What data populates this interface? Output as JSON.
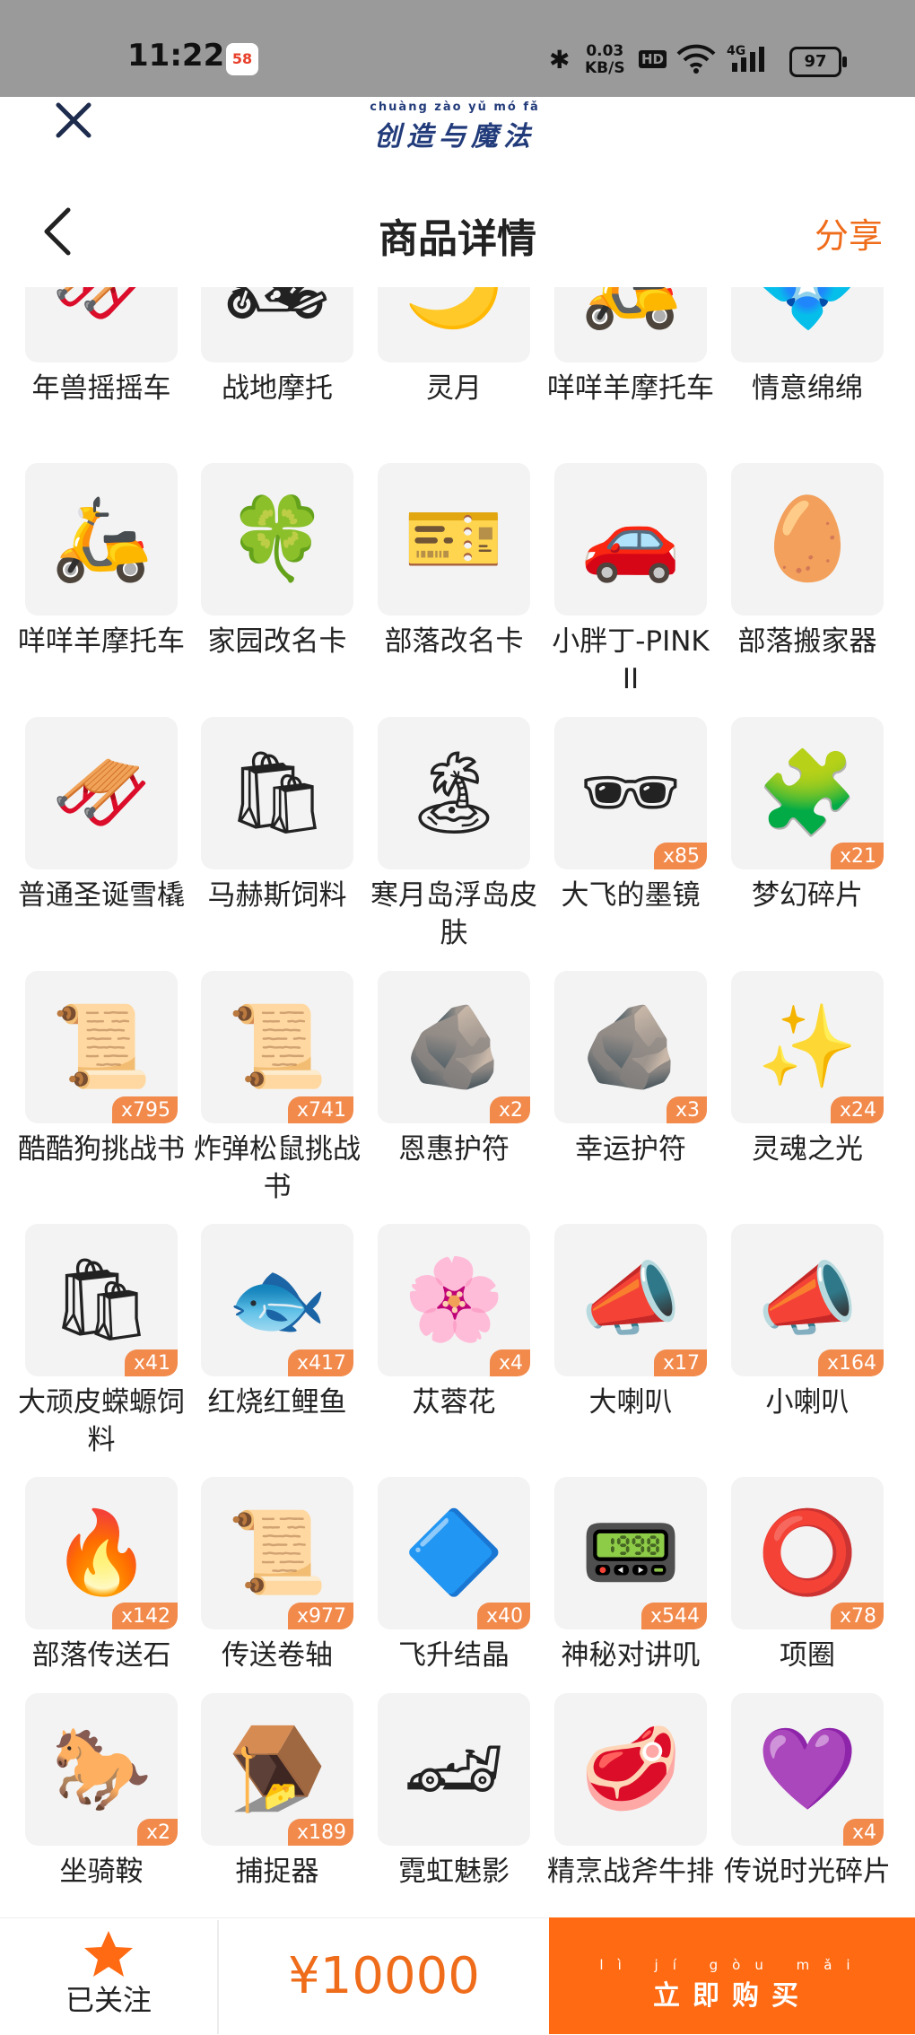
{
  "status_bar": {
    "time": "11:22",
    "app_badge": "58",
    "network_speed": "0.03\nKB/S",
    "hd": "HD",
    "network": "4G",
    "battery": "97"
  },
  "logo": {
    "pinyin": "chuàng zào yǔ mó fǎ",
    "text": "创造与魔法"
  },
  "nav": {
    "title": "商品详情",
    "share": "分享"
  },
  "items": [
    {
      "name": "年兽摇摇车",
      "icon": "sleigh-car-icon",
      "count": ""
    },
    {
      "name": "战地摩托",
      "icon": "motorbike-icon",
      "count": ""
    },
    {
      "name": "灵月",
      "icon": "moon-icon",
      "count": ""
    },
    {
      "name": "咩咩羊摩托车",
      "icon": "sheep-scooter-icon",
      "count": ""
    },
    {
      "name": "情意绵绵",
      "icon": "crystal-ornament-icon",
      "count": ""
    },
    {
      "name": "咩咩羊摩托车",
      "icon": "sheep-scooter-icon",
      "count": ""
    },
    {
      "name": "家园改名卡",
      "icon": "green-card-icon",
      "count": ""
    },
    {
      "name": "部落改名卡",
      "icon": "orange-card-icon",
      "count": ""
    },
    {
      "name": "小胖丁-PINK II",
      "icon": "pink-car-icon",
      "count": ""
    },
    {
      "name": "部落搬家器",
      "icon": "crystal-egg-icon",
      "count": ""
    },
    {
      "name": "普通圣诞雪橇",
      "icon": "sleigh-icon",
      "count": ""
    },
    {
      "name": "马赫斯饲料",
      "icon": "feed-bag-icon",
      "count": ""
    },
    {
      "name": "寒月岛浮岛皮肤",
      "icon": "floating-island-icon",
      "count": ""
    },
    {
      "name": "大飞的墨镜",
      "icon": "sunglasses-icon",
      "count": "x85"
    },
    {
      "name": "梦幻碎片",
      "icon": "puzzle-piece-icon",
      "count": "x21"
    },
    {
      "name": "酷酷狗挑战书",
      "icon": "wanted-poster-icon",
      "count": "x795"
    },
    {
      "name": "炸弹松鼠挑战书",
      "icon": "wanted-poster-icon",
      "count": "x741"
    },
    {
      "name": "恩惠护符",
      "icon": "stone-amulet-icon",
      "count": "x2"
    },
    {
      "name": "幸运护符",
      "icon": "stone-amulet-icon",
      "count": "x3"
    },
    {
      "name": "灵魂之光",
      "icon": "golden-light-icon",
      "count": "x24"
    },
    {
      "name": "大顽皮蝾螈饲料",
      "icon": "feed-bag-icon",
      "count": "x41"
    },
    {
      "name": "红烧红鲤鱼",
      "icon": "fish-dish-icon",
      "count": "x417"
    },
    {
      "name": "苁蓉花",
      "icon": "purple-flower-icon",
      "count": "x4"
    },
    {
      "name": "大喇叭",
      "icon": "megaphone-icon",
      "count": "x17"
    },
    {
      "name": "小喇叭",
      "icon": "megaphone-icon",
      "count": "x164"
    },
    {
      "name": "部落传送石",
      "icon": "teleport-stone-icon",
      "count": "x142"
    },
    {
      "name": "传送卷轴",
      "icon": "scroll-icon",
      "count": "x977"
    },
    {
      "name": "飞升结晶",
      "icon": "crystal-icon",
      "count": "x40"
    },
    {
      "name": "神秘对讲叽",
      "icon": "walkie-talkie-icon",
      "count": "x544"
    },
    {
      "name": "项圈",
      "icon": "collar-icon",
      "count": "x78"
    },
    {
      "name": "坐骑鞍",
      "icon": "saddle-icon",
      "count": "x2"
    },
    {
      "name": "捕捉器",
      "icon": "trap-icon",
      "count": "x189"
    },
    {
      "name": "霓虹魅影",
      "icon": "neon-car-icon",
      "count": ""
    },
    {
      "name": "精烹战斧牛排",
      "icon": "steak-dish-icon",
      "count": ""
    },
    {
      "name": "传说时光碎片",
      "icon": "purple-shard-icon",
      "count": "x4"
    }
  ],
  "bottom": {
    "follow_label": "已关注",
    "price": "¥10000",
    "buy_pinyin": "lì jí gòu mǎi",
    "buy_label": "立即购买"
  },
  "colors": {
    "accent": "#ff6a13",
    "badge": "#f28a4c",
    "tile_bg": "#f3f3f3"
  }
}
